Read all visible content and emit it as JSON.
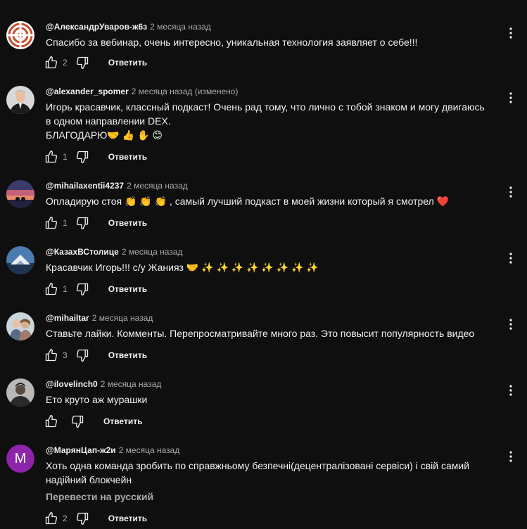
{
  "comments": [
    {
      "author": "@АлександрУваров-ж6з",
      "time": "2 месяца назад",
      "lines": [
        "Спасибо за вебинар, очень интересно, уникальная технология заявляет о себе!!!"
      ],
      "likes": "2",
      "reply": "Ответить",
      "avatar": "pattern-avatar"
    },
    {
      "author": "@alexander_spomer",
      "time": "2 месяца назад (изменено)",
      "lines": [
        "Игорь красавчик, классный подкаст! Очень рад тому, что лично с тобой знаком и могу двигаюсь",
        "в одном направлении DEX.",
        "БЛАГОДАРЮ🤝 👍 ✋ 😊"
      ],
      "likes": "1",
      "reply": "Ответить",
      "avatar": "photo-avatar"
    },
    {
      "author": "@mihailaxentii4237",
      "time": "2 месяца назад",
      "lines": [
        "Опладирую стоя 👏 👏 👏 , самый лучший подкаст в моей жизни который я смотрел ❤️"
      ],
      "likes": "1",
      "reply": "Ответить",
      "avatar": "sunset-avatar"
    },
    {
      "author": "@КазахВСтолице",
      "time": "2 месяца назад",
      "lines": [
        "Красавчик Игорь!!! с/у Жанияз 🤝 ✨ ✨ ✨ ✨ ✨ ✨ ✨ ✨"
      ],
      "likes": "1",
      "reply": "Ответить",
      "avatar": "mountain-avatar"
    },
    {
      "author": "@mihailtar",
      "time": "2 месяца назад",
      "lines": [
        "Ставьте лайки. Комменты.  Перепросматривайте много раз. Это повысит популярность видео"
      ],
      "likes": "3",
      "reply": "Ответить",
      "avatar": "people-avatar"
    },
    {
      "author": "@ilovelinch0",
      "time": "2 месяца назад",
      "lines": [
        "Ето круто аж мурашки"
      ],
      "likes": "",
      "reply": "Ответить",
      "avatar": "person-avatar"
    },
    {
      "author": "@МарянЦап-ж2и",
      "time": "2 месяца назад",
      "lines": [
        "Хоть одна команда зробить по справжньому безпечні(децентралізовані сервіси) і свій самий",
        "надійний блокчейн"
      ],
      "translate": "Перевести на русский",
      "likes": "2",
      "reply": "Ответить",
      "avatar": "letter-avatar",
      "avatar_letter": "M",
      "avatar_color": "#8e24aa"
    }
  ]
}
